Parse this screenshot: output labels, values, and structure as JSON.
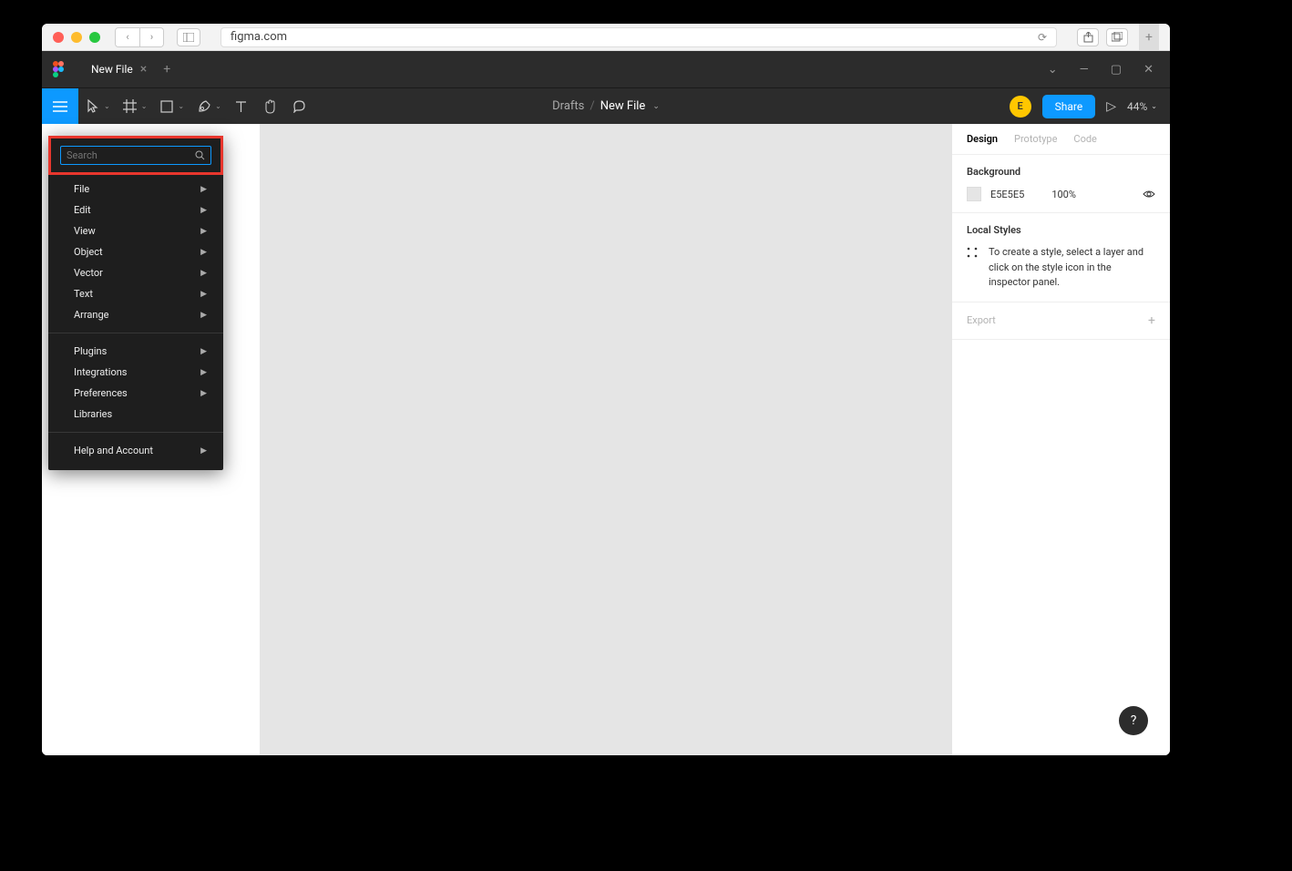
{
  "browser": {
    "url": "figma.com",
    "new_tab": "+"
  },
  "titlebar": {
    "tab_name": "New File",
    "tab_close": "×",
    "tab_add": "+"
  },
  "toolbar": {
    "breadcrumb_parent": "Drafts",
    "breadcrumb_current": "New File",
    "avatar_initial": "E",
    "share_label": "Share",
    "zoom": "44%"
  },
  "dropdown": {
    "search_placeholder": "Search",
    "items_a": [
      "File",
      "Edit",
      "View",
      "Object",
      "Vector",
      "Text",
      "Arrange"
    ],
    "items_b": [
      "Plugins",
      "Integrations",
      "Preferences",
      "Libraries"
    ],
    "items_c": [
      "Help and Account"
    ],
    "no_submenu": [
      "Libraries"
    ]
  },
  "right_panel": {
    "tabs": [
      "Design",
      "Prototype",
      "Code"
    ],
    "background_label": "Background",
    "bg_hex": "E5E5E5",
    "bg_opacity": "100%",
    "local_styles_label": "Local Styles",
    "local_styles_hint": "To create a style, select a layer and click on the style icon in the inspector panel.",
    "export_label": "Export",
    "export_plus": "+"
  },
  "help": "?"
}
